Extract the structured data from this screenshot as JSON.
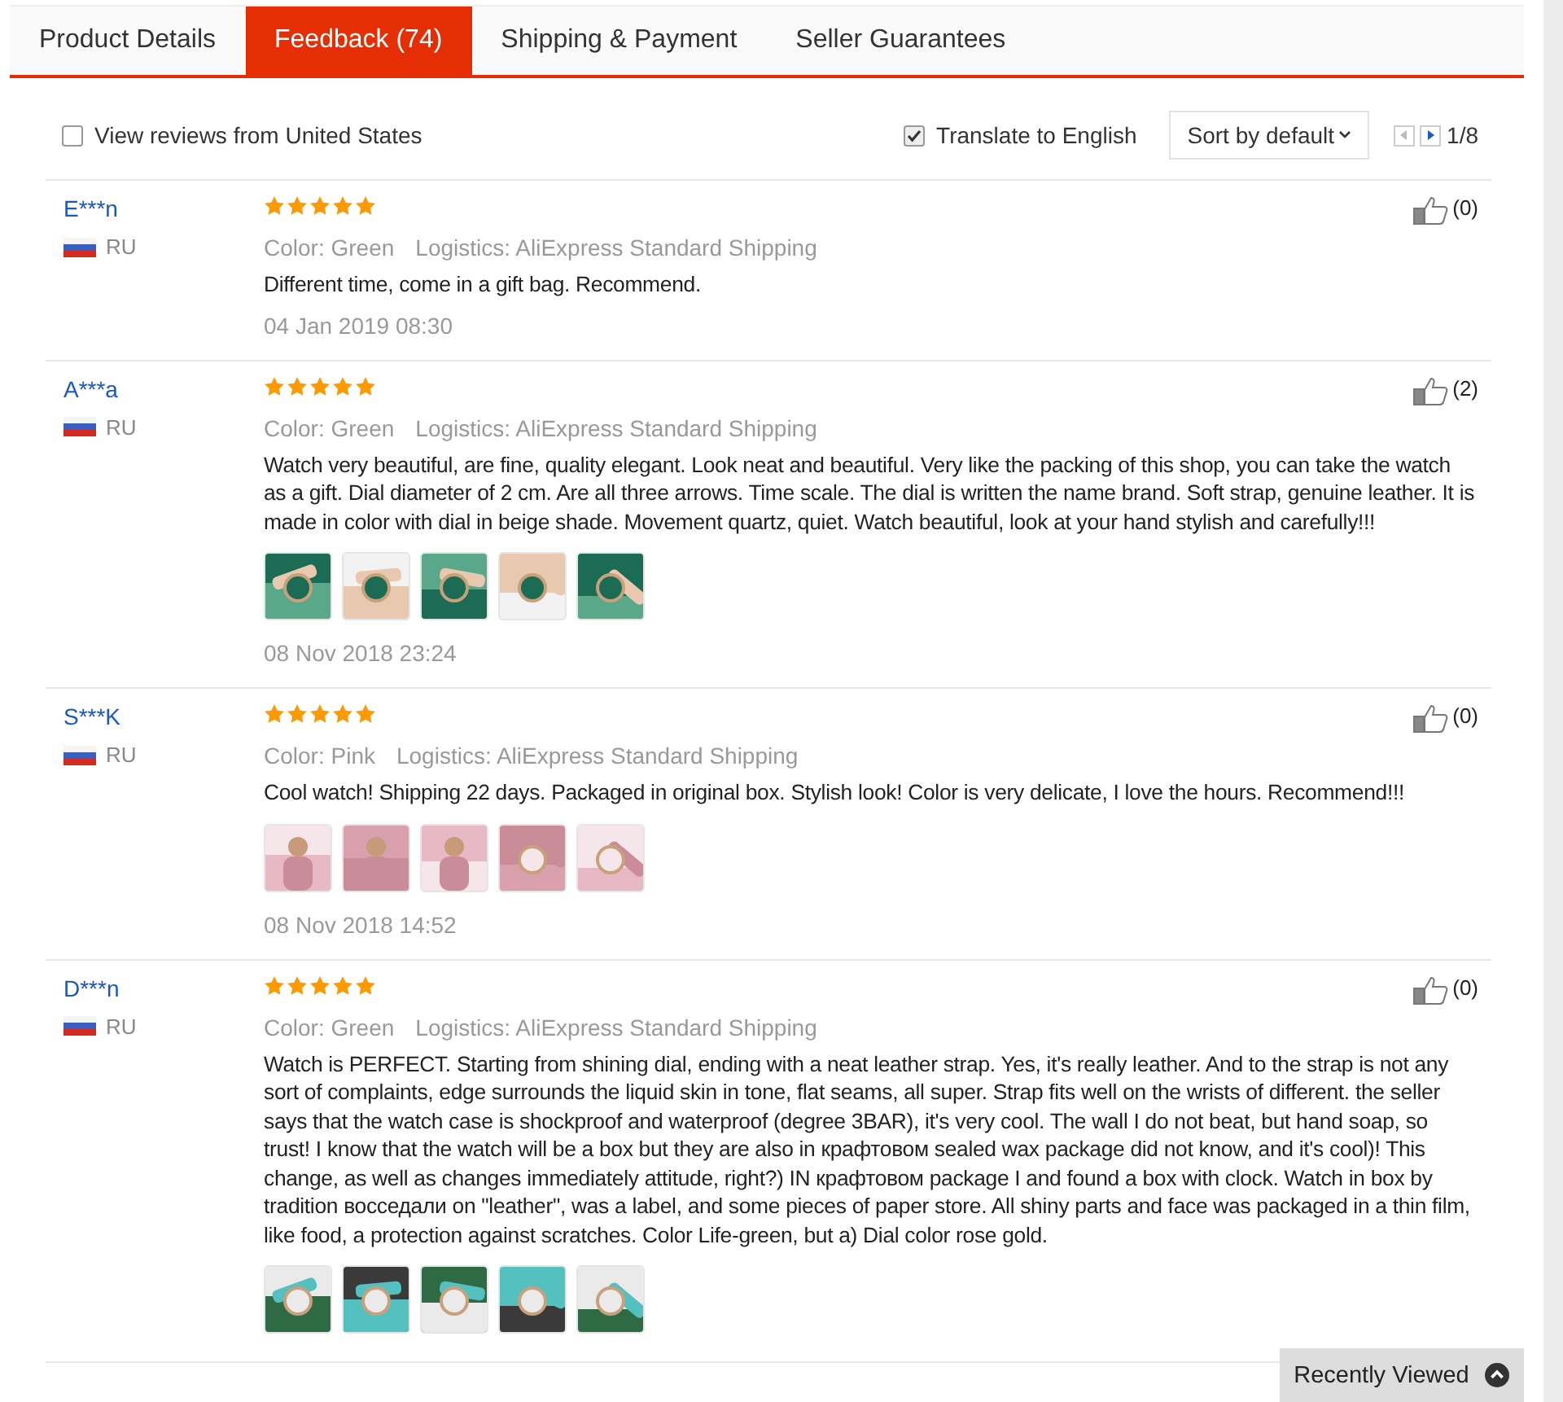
{
  "tabs": [
    {
      "label": "Product Details",
      "selected": false
    },
    {
      "label": "Feedback (74)",
      "selected": true
    },
    {
      "label": "Shipping & Payment",
      "selected": false
    },
    {
      "label": "Seller Guarantees",
      "selected": false
    }
  ],
  "toolbar": {
    "country_filter": {
      "label": "View reviews from United States",
      "checked": false
    },
    "translate": {
      "label": "Translate to English",
      "checked": true
    },
    "sort": "Sort by default",
    "page": "1/8"
  },
  "reviews": [
    {
      "name": "E***n",
      "country": "RU",
      "stars": 5,
      "color_label": "Color:",
      "color_name": "Green",
      "logistics_label": "Logistics:",
      "logistics": "AliExpress Standard Shipping",
      "text": "Different time, come in a gift bag. Recommend.",
      "date": "04 Jan 2019 08:30",
      "helpful": "(0)"
    },
    {
      "name": "A***a",
      "country": "RU",
      "stars": 5,
      "color_label": "Color:",
      "color_name": "Green",
      "logistics_label": "Logistics:",
      "logistics": "AliExpress Standard Shipping",
      "text": "Watch very beautiful, are fine, quality elegant. Look neat and beautiful. Very like the packing of this shop, you can take the watch as a gift. Dial diameter of 2 cm. Are all three arrows. Time scale. The dial is written the name brand. Soft strap, genuine leather. It is made in color with dial in beige shade. Movement quartz, quiet. Watch beautiful, look at your hand stylish and carefully!!!",
      "photos": [
        {
          "kind": "picture"
        },
        {
          "kind": "picture"
        },
        {
          "kind": "picture"
        },
        {
          "kind": "picture"
        },
        {
          "kind": "picture"
        }
      ],
      "date": "08 Nov 2018 23:24",
      "helpful": "(2)"
    },
    {
      "name": "S***K",
      "country": "RU",
      "stars": 5,
      "color_label": "Color:",
      "color_name": "Pink",
      "logistics_label": "Logistics:",
      "logistics": "AliExpress Standard Shipping",
      "text": "Cool watch! Shipping 22 days. Packaged in original box. Stylish look! Color is very delicate, I love the hours. Recommend!!!",
      "photos": [
        {
          "kind": "picture"
        },
        {
          "kind": "picture"
        },
        {
          "kind": "picture"
        },
        {
          "kind": "picture"
        },
        {
          "kind": "picture"
        }
      ],
      "date": "08 Nov 2018 14:52",
      "helpful": "(0)"
    },
    {
      "name": "D***n",
      "country": "RU",
      "stars": 5,
      "color_label": "Color:",
      "color_name": "Green",
      "logistics_label": "Logistics:",
      "logistics": "AliExpress Standard Shipping",
      "text": "Watch is PERFECT. Starting from shining dial, ending with a neat leather strap. Yes, it's really leather. And to the strap is not any sort of complaints, edge surrounds the liquid skin in tone, flat seams, all super. Strap fits well on the wrists of different. the seller says that the watch case is shockproof and waterproof (degree 3BAR), it's very cool. The wall I do not beat, but hand soap, so trust! I know that the watch will be a box but they are also in крафтовом sealed wax package did not know, and it's cool)! This change, as well as changes immediately attitude, right?) IN крафтовом package I and found a box with clock. Watch in box by tradition восседали on \"leather\", was a label, and some pieces of paper store. All shiny parts and face was packaged in a thin film, like food, a protection against scratches. Color Life-green, but a) Dial color rose gold.",
      "photos": [
        {
          "kind": "picture"
        },
        {
          "kind": "picture"
        },
        {
          "kind": "picture"
        },
        {
          "kind": "picture"
        },
        {
          "kind": "picture"
        }
      ],
      "helpful": "(0)"
    }
  ],
  "recently_viewed": "Recently Viewed"
}
